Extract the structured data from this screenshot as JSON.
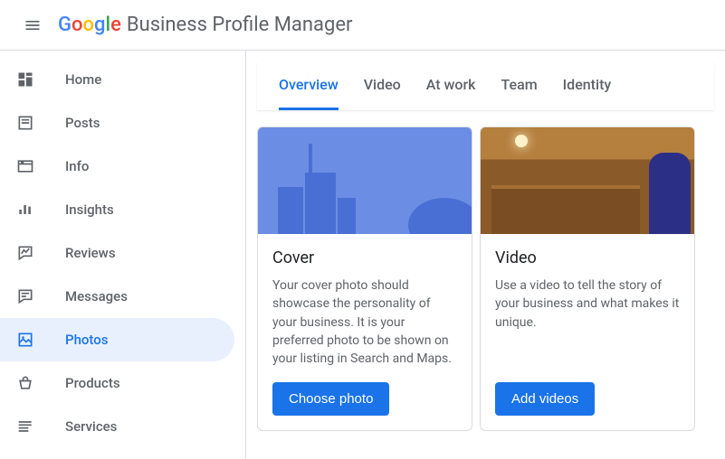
{
  "brand": {
    "letters": [
      {
        "c": "G",
        "color": "#4285F4"
      },
      {
        "c": "o",
        "color": "#EA4335"
      },
      {
        "c": "o",
        "color": "#FBBC05"
      },
      {
        "c": "g",
        "color": "#4285F4"
      },
      {
        "c": "l",
        "color": "#34A853"
      },
      {
        "c": "e",
        "color": "#EA4335"
      }
    ],
    "product": "Business Profile Manager"
  },
  "nav": [
    {
      "key": "home",
      "label": "Home",
      "active": false
    },
    {
      "key": "posts",
      "label": "Posts",
      "active": false
    },
    {
      "key": "info",
      "label": "Info",
      "active": false
    },
    {
      "key": "insights",
      "label": "Insights",
      "active": false
    },
    {
      "key": "reviews",
      "label": "Reviews",
      "active": false
    },
    {
      "key": "messages",
      "label": "Messages",
      "active": false
    },
    {
      "key": "photos",
      "label": "Photos",
      "active": true
    },
    {
      "key": "products",
      "label": "Products",
      "active": false
    },
    {
      "key": "services",
      "label": "Services",
      "active": false
    }
  ],
  "tabs": [
    {
      "label": "Overview",
      "active": true
    },
    {
      "label": "Video",
      "active": false
    },
    {
      "label": "At work",
      "active": false
    },
    {
      "label": "Team",
      "active": false
    },
    {
      "label": "Identity",
      "active": false
    }
  ],
  "cards": {
    "cover": {
      "title": "Cover",
      "desc": "Your cover photo should showcase the personality of your business. It is your preferred photo to be shown on your listing in Search and Maps.",
      "button": "Choose photo"
    },
    "video": {
      "title": "Video",
      "desc": "Use a video to tell the story of your business and what makes it unique.",
      "button": "Add videos"
    }
  },
  "colors": {
    "accent": "#1a73e8"
  }
}
